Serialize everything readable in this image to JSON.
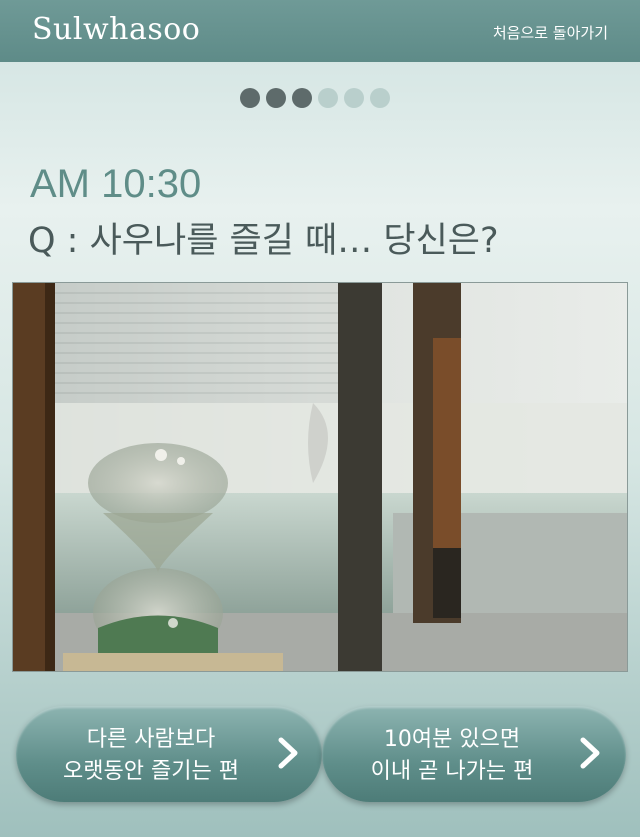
{
  "header": {
    "logo": "Sulwhasoo",
    "back_link": "처음으로 돌아가기"
  },
  "progress": {
    "current": 3,
    "total": 6,
    "active_color": "#5e6b6b",
    "inactive_color": "#b9cfcc"
  },
  "question": {
    "time": "AM 10:30",
    "text": "Q : 사우나를 즐길 때… 당신은?"
  },
  "photo": {
    "description_icon": "sauna-hourglass-photo"
  },
  "options": [
    {
      "line1": "다른 사람보다",
      "line2": "오랫동안 즐기는 편",
      "icon": "chevron-right-icon"
    },
    {
      "line1": "10여분 있으면",
      "line2": "이내 곧 나가는 편",
      "icon": "chevron-right-icon"
    }
  ],
  "colors": {
    "header_bg": "#5e8b88",
    "time_color": "#5f8d88",
    "question_color": "#4a5a5a",
    "button_bg": "#6a9894"
  }
}
